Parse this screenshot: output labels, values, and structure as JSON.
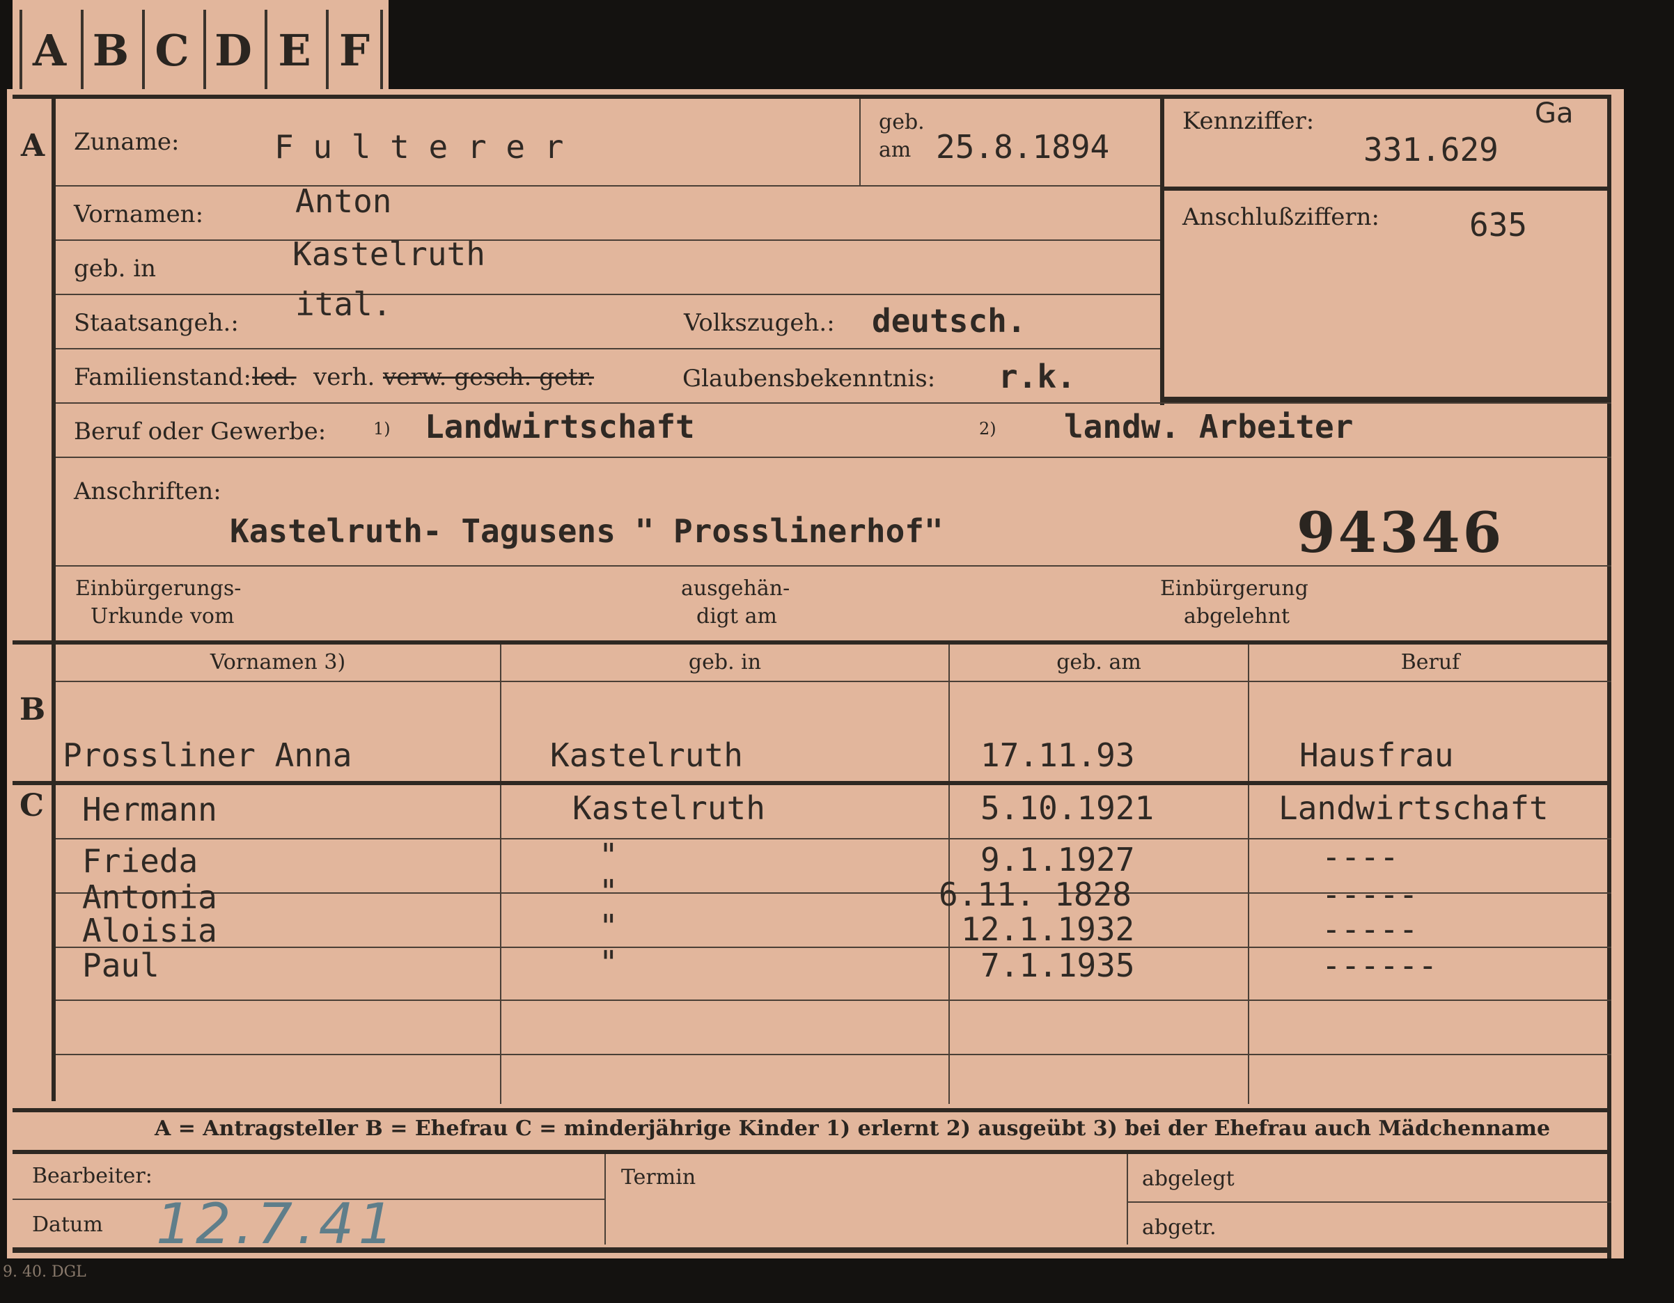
{
  "tabs": [
    "A",
    "B",
    "C",
    "D",
    "E",
    "F"
  ],
  "section_a": {
    "marker": "A",
    "zuname_label": "Zuname:",
    "zuname_value": "F u l t e r e r",
    "geb_label_1": "geb.",
    "geb_label_2": "am",
    "geb_am_value": "25.8.1894",
    "kennziffer_label": "Kennziffer:",
    "kennziffer_value": "331.629",
    "kennziffer_suffix": "Ga",
    "anschluss_label": "Anschlußziffern:",
    "anschluss_value": "635",
    "vornamen_label": "Vornamen:",
    "vornamen_value": "Anton",
    "geb_in_label": "geb. in",
    "geb_in_value": "Kastelruth",
    "staatsangeh_label": "Staatsangeh.:",
    "staatsangeh_value": "ital.",
    "volkszugeh_label": "Volkszugeh.:",
    "volkszugeh_value": "deutsch.",
    "familienstand_label": "Familienstand:",
    "familienstand_struck_1": "led.",
    "familienstand_value": "verh.",
    "familienstand_struck_2": "verw. gesch. getr.",
    "glaubens_label": "Glaubensbekenntnis:",
    "glaubens_value": "r.k.",
    "beruf_label": "Beruf oder Gewerbe:",
    "beruf_fn1": "1)",
    "beruf_value_1": "Landwirtschaft",
    "beruf_fn2": "2)",
    "beruf_value_2": "landw. Arbeiter",
    "anschriften_label": "Anschriften:",
    "anschriften_value": "Kastelruth- Tagusens \" Prosslinerhof\"",
    "stamp_number": "94346",
    "einb_urkunde_1": "Einbürgerungs-",
    "einb_urkunde_2": "Urkunde vom",
    "ausgehaendigt_1": "ausgehän-",
    "ausgehaendigt_2": "digt am",
    "einb_abgelehnt_1": "Einbürgerung",
    "einb_abgelehnt_2": "abgelehnt"
  },
  "section_b": {
    "marker": "B",
    "headers": [
      "Vornamen 3)",
      "geb. in",
      "geb. am",
      "Beruf"
    ],
    "row": [
      "Prossliner Anna",
      "Kastelruth",
      "17.11.93",
      "Hausfrau"
    ]
  },
  "section_c": {
    "marker": "C",
    "rows": [
      [
        "Hermann",
        "Kastelruth",
        "5.10.1921",
        "Landwirtschaft"
      ],
      [
        "Frieda",
        "\"",
        "9.1.1927",
        "----"
      ],
      [
        "Antonia",
        "\"",
        "6.11. 1828",
        "-----"
      ],
      [
        "Aloisia",
        "\"",
        "12.1.1932",
        "-----"
      ],
      [
        "Paul",
        "\"",
        "7.1.1935",
        "------"
      ]
    ]
  },
  "legend": "A = Antragsteller    B = Ehefrau    C = minderjährige Kinder    1) erlernt    2) ausgeübt    3) bei der Ehefrau auch Mädchenname",
  "footer": {
    "bearbeiter_label": "Bearbeiter:",
    "datum_label": "Datum",
    "datum_value": "12.7.41",
    "termin_label": "Termin",
    "abgelegt_label": "abgelegt",
    "abgetr_label": "abgetr.",
    "print_code": "9. 40. DGL"
  }
}
